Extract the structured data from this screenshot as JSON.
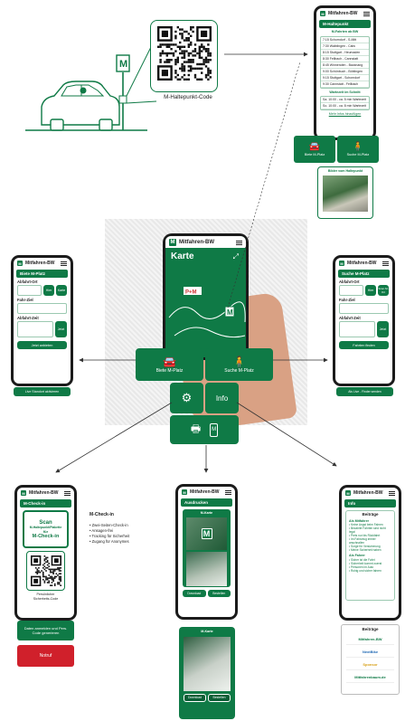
{
  "scene": {
    "qr_caption": "M-Haltepunkt-Code"
  },
  "main_phone": {
    "app_title": "Mitfahren-BW",
    "map_title": "Karte"
  },
  "actions": {
    "offer": "Biete M-Platz",
    "search": "Suche M-Platz",
    "info": "Info"
  },
  "phone_top_right": {
    "header": "M-Haltepunkt",
    "section1": "M-Fahrten ab BW",
    "rows": [
      "7:15 Schorndorf - S-Mitt",
      "7:30 Waiblingen - Calw",
      "8:15 Stuttgart - Heumaden",
      "8:30 Fellbach - Cannstatt",
      "8:45 Winnenden - Backnang",
      "9:00 Schönbuch - Böblingen",
      "9:15 Stuttgart - Schorndorf",
      "9:30 Cannstatt - Fellbach"
    ],
    "section2": "Wartezeit im Schnitt",
    "waits": [
      "Sa. 10:00 - ca. 5 min Wartezeit",
      "So. 10:00 - ca. 8 min Wartezeit"
    ],
    "link": "Mehr Infos hinzufügen",
    "btn_offer": "Biete M-Platz",
    "btn_search": "Suche M-Platz",
    "photo_caption": "Bilder vom Haltepunkt"
  },
  "phone_left": {
    "app_title": "Mitfahren-BW",
    "tab": "Biete M-Platz",
    "label_from": "Abfahrt-Ort",
    "chip_a": "Hier",
    "chip_b": "Karte",
    "label_to": "Fahr-Ziel",
    "label_time": "Abfahrt-Zeit",
    "btn_go": "Jetzt",
    "btn_offer": "Jetzt anbieten",
    "btn_live": "Live Standort aktivieren"
  },
  "phone_right": {
    "app_title": "Mitfahren-BW",
    "tab": "Suche M-Platz",
    "label_from": "Abfahrt-Ort",
    "chip_a": "Hier",
    "chip_b": "Scan M-Ort",
    "label_to": "Fahr-Ziel",
    "label_time": "Abfahrt-Zeit",
    "btn_go": "Jetzt",
    "btn_find": "Fahrten finden",
    "btn_live": "Als Live - Finder senden"
  },
  "phone_bottom_left": {
    "app_title": "Mitfahren-BW",
    "bar": "M-Check-in",
    "scan1": "Scan",
    "scan2": "M-Haltepunkt/Plakette",
    "scan3": "für",
    "scan4": "M-Check-in",
    "qr_caption1": "Persönlicher",
    "qr_caption2": "Sicherheits-Code",
    "btn_register": "Daten anmelden und Pers. Code generieren",
    "btn_emergency": "Notruf"
  },
  "checkin_notes": {
    "title": "M-Check-in",
    "items": [
      "Zwei-Seiten-Check-in",
      "Ansagen-frei",
      "Tracking für Sicherheit",
      "Zugang für Anonymes"
    ]
  },
  "phone_bottom_center": {
    "app_title": "Mitfahren-BW",
    "bar": "Ausdrucken",
    "card_title": "M-Karte",
    "btn_download": "Download",
    "btn_print": "Bestellen",
    "card2_title": "M-Karte",
    "btn_download2": "Download",
    "btn_print2": "Bestellen"
  },
  "phone_bottom_right": {
    "app_title": "Mitfahren-BW",
    "bar": "Info",
    "card_title": "Beiträge",
    "h1": "Als Mitfahrer",
    "l1": [
      "Keine Angst beim Fahren",
      "Bezahlte Fahrten sind nicht legal",
      "Preis nur bis Rückfahrt",
      "Im Fahrzeug immer anschnallen",
      "Sorge für Versicherung",
      "Meine Sicherheit haben"
    ],
    "h2": "Als Fahrer",
    "l2": [
      "Sicher ist die Fahrt",
      "Sicherheit kommt zuerst",
      "Personen im Auto",
      "Ruhig und sicher fahren"
    ],
    "card2_title": "Beiträge",
    "sponsors": [
      "Mitfahren-BW",
      "NextBike",
      "Sponsor",
      "Mitfahrenbaum.de"
    ]
  }
}
